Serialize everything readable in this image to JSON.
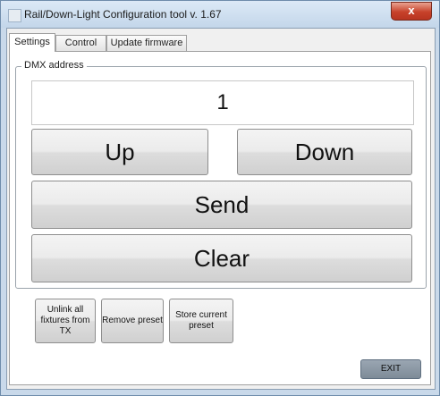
{
  "window": {
    "title": "Rail/Down-Light Configuration tool v. 1.67",
    "close_symbol": "x",
    "icon": "app-icon"
  },
  "tabs": [
    {
      "label": "Settings",
      "active": true
    },
    {
      "label": "Control",
      "active": false
    },
    {
      "label": "Update firmware",
      "active": false
    }
  ],
  "dmx": {
    "group_label": "DMX address",
    "value": "1"
  },
  "buttons": {
    "up": "Up",
    "down": "Down",
    "send": "Send",
    "clear": "Clear",
    "unlink": "Unlink all fixtures from TX",
    "remove": "Remove preset",
    "store": "Store current preset",
    "exit": "EXIT"
  },
  "colors": {
    "close_button": "#c7412a",
    "exit_button": "#8a96a3"
  }
}
